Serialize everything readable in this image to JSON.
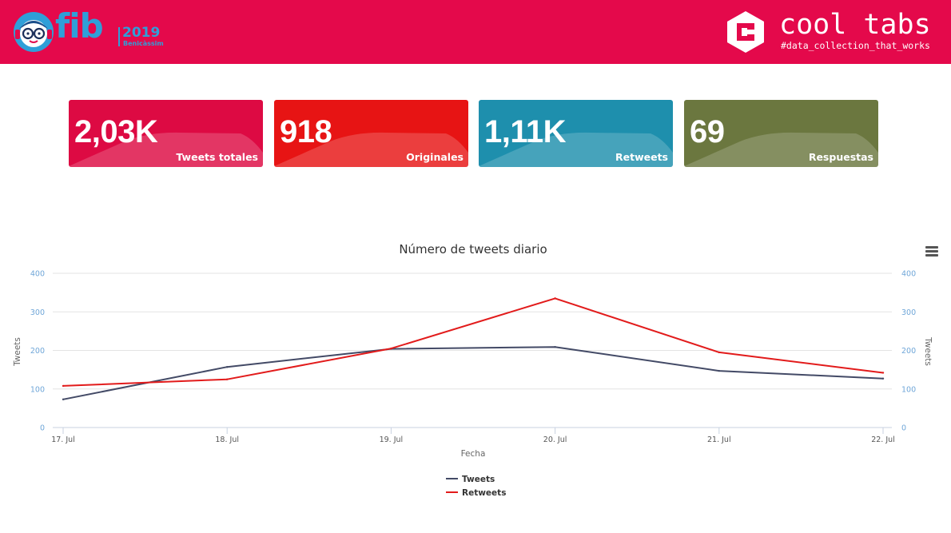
{
  "header": {
    "background": "#e4094b",
    "fib_logo": {
      "word": "fib",
      "year": "2019",
      "city": "Benicàssim",
      "icon": "mascot-icon",
      "color": "#2f9fd8"
    },
    "cooltabs_logo": {
      "title": "cool tabs",
      "tagline": "#data_collection_that_works",
      "icon": "cooltabs-hexagon-icon"
    }
  },
  "kpis": [
    {
      "value": "2,03K",
      "label": "Tweets totales",
      "color": "#dd0a43"
    },
    {
      "value": "918",
      "label": "Originales",
      "color": "#e71414"
    },
    {
      "value": "1,11K",
      "label": "Retweets",
      "color": "#1e8fad"
    },
    {
      "value": "69",
      "label": "Respuestas",
      "color": "#6b773f"
    }
  ],
  "chart_menu_icon": "hamburger-menu-icon",
  "chart_data": {
    "type": "line",
    "title": "Número de tweets diario",
    "xlabel": "Fecha",
    "ylabel": "Tweets",
    "ylabel_right": "Tweets",
    "categories": [
      "17. Jul",
      "18. Jul",
      "19. Jul",
      "20. Jul",
      "21. Jul",
      "22. Jul"
    ],
    "ylim": [
      0,
      400
    ],
    "yticks": [
      0,
      100,
      200,
      300,
      400
    ],
    "grid": true,
    "legend_position": "bottom-center",
    "series": [
      {
        "name": "Tweets",
        "color": "#434a66",
        "values": [
          73,
          157,
          204,
          209,
          147,
          127
        ]
      },
      {
        "name": "Retweets",
        "color": "#e21b1b",
        "values": [
          108,
          125,
          205,
          335,
          195,
          142
        ]
      }
    ]
  }
}
